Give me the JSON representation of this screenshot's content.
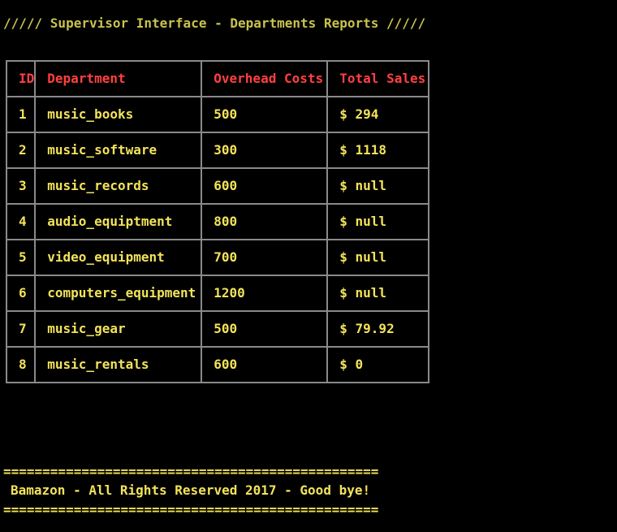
{
  "terminal": {
    "title": "///// Supervisor Interface - Departments Reports /////"
  },
  "table": {
    "headers": [
      "ID",
      "Department",
      "Overhead Costs",
      "Total Sales"
    ],
    "rows": [
      [
        "1",
        "music_books",
        "500",
        "$ 294"
      ],
      [
        "2",
        "music_software",
        "300",
        "$ 1118"
      ],
      [
        "3",
        "music_records",
        "600",
        "$ null"
      ],
      [
        "4",
        "audio_equiptment",
        "800",
        "$ null"
      ],
      [
        "5",
        "video_equipment",
        "700",
        "$ null"
      ],
      [
        "6",
        "computers_equipment",
        "1200",
        "$ null"
      ],
      [
        "7",
        "music_gear",
        "500",
        "$ 79.92"
      ],
      [
        "8",
        "music_rentals",
        "600",
        "$ 0"
      ]
    ]
  },
  "footer": {
    "rule_top": "================================================",
    "message": "Bamazon - All Rights Reserved 2017 - Good bye!",
    "rule_bottom": "================================================"
  },
  "colors": {
    "background": "#000000",
    "text": "#f2e35a",
    "title": "#c9c24e",
    "header": "#ff4040",
    "border": "#8a8a8a"
  }
}
